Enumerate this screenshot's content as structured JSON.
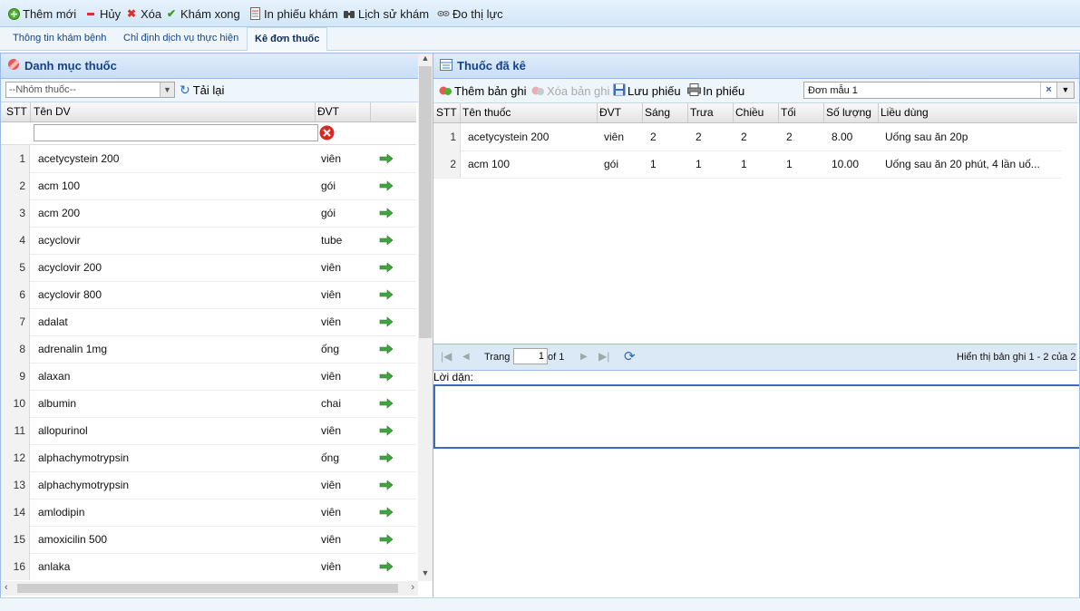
{
  "toolbar": {
    "new_label": "Thêm mới",
    "cancel_label": "Hủy",
    "delete_label": "Xóa",
    "done_label": "Khám xong",
    "print_label": "In phiếu khám",
    "history_label": "Lịch sử khám",
    "vision_label": "Đo thị lực"
  },
  "tabs": [
    "Thông tin khám bệnh",
    "Chỉ định dịch vụ thực hiện",
    "Kê đơn thuốc"
  ],
  "left": {
    "title": "Danh mục thuốc",
    "group_placeholder": "--Nhóm thuốc--",
    "reload_label": "Tải lại",
    "headers": {
      "stt": "STT",
      "name": "Tên DV",
      "unit": "ĐVT"
    },
    "rows": [
      {
        "stt": "1",
        "name": "acetycystein 200",
        "unit": "viên"
      },
      {
        "stt": "2",
        "name": "acm 100",
        "unit": "gói"
      },
      {
        "stt": "3",
        "name": "acm 200",
        "unit": "gói"
      },
      {
        "stt": "4",
        "name": "acyclovir",
        "unit": "tube"
      },
      {
        "stt": "5",
        "name": "acyclovir 200",
        "unit": "viên"
      },
      {
        "stt": "6",
        "name": "acyclovir 800",
        "unit": "viên"
      },
      {
        "stt": "7",
        "name": "adalat",
        "unit": "viên"
      },
      {
        "stt": "8",
        "name": "adrenalin 1mg",
        "unit": "ống"
      },
      {
        "stt": "9",
        "name": "alaxan",
        "unit": "viên"
      },
      {
        "stt": "10",
        "name": "albumin",
        "unit": "chai"
      },
      {
        "stt": "11",
        "name": "allopurinol",
        "unit": "viên"
      },
      {
        "stt": "12",
        "name": "alphachymotrypsin",
        "unit": "ống"
      },
      {
        "stt": "13",
        "name": "alphachymotrypsin",
        "unit": "viên"
      },
      {
        "stt": "14",
        "name": "amlodipin",
        "unit": "viên"
      },
      {
        "stt": "15",
        "name": "amoxicilin 500",
        "unit": "viên"
      },
      {
        "stt": "16",
        "name": "anlaka",
        "unit": "viên"
      }
    ]
  },
  "right": {
    "title": "Thuốc đã kê",
    "add_label": "Thêm bản ghi",
    "remove_label": "Xóa bản ghi",
    "save_label": "Lưu phiếu",
    "print_label": "In phiếu",
    "template_value": "Đơn mẫu 1",
    "headers": {
      "stt": "STT",
      "name": "Tên thuốc",
      "unit": "ĐVT",
      "morning": "Sáng",
      "noon": "Trưa",
      "afternoon": "Chiều",
      "night": "Tối",
      "qty": "Số lượng",
      "dosage": "Liều dùng"
    },
    "rows": [
      {
        "stt": "1",
        "name": "acetycystein 200",
        "unit": "viên",
        "morning": "2",
        "noon": "2",
        "afternoon": "2",
        "night": "2",
        "qty": "8.00",
        "dosage": "Uống sau ăn 20p"
      },
      {
        "stt": "2",
        "name": "acm 100",
        "unit": "gói",
        "morning": "1",
        "noon": "1",
        "afternoon": "1",
        "night": "1",
        "qty": "10.00",
        "dosage": "Uống sau ăn 20 phút, 4 lần uố..."
      }
    ],
    "pager": {
      "page_label": "Trang",
      "page_value": "1",
      "of_label": "of 1",
      "summary": "Hiển thị bản ghi 1 - 2 của 2"
    },
    "note_label": "Lời dặn:",
    "note_value": ""
  },
  "colors": {
    "accent": "#15428b",
    "panel_border": "#99bbe8",
    "arrow": "#3fa33f"
  }
}
